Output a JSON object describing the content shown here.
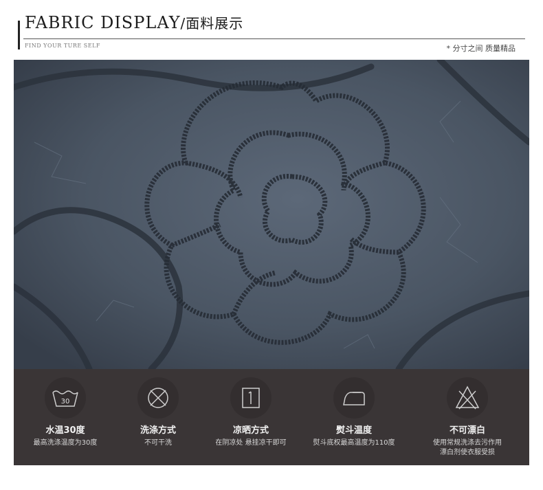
{
  "header": {
    "title_en": "FABRIC DISPLAY",
    "title_zh": "/面料展示",
    "subtitle_en": "FIND YOUR TURE SELF",
    "subtitle_zh": "* 分寸之间 质量精品"
  },
  "photo": {
    "subject": "fabric-closeup",
    "color": "#4d5866"
  },
  "care": {
    "background": "#3a3536",
    "items": [
      {
        "icon": "wash-30-icon",
        "icon_text": "30",
        "title": "水温30度",
        "desc": "最高洗涤温度为30度"
      },
      {
        "icon": "no-wash-icon",
        "title": "洗涤方式",
        "desc": "不可干洗"
      },
      {
        "icon": "drip-dry-icon",
        "title": "凉晒方式",
        "desc": "在阴凉处 悬挂凉干即可"
      },
      {
        "icon": "iron-icon",
        "title": "熨斗温度",
        "desc": "熨斗底权最高温度为110度"
      },
      {
        "icon": "no-bleach-icon",
        "title": "不可漂白",
        "desc": "使用常规洗涤去污作用\n漂白剂使衣服受损"
      }
    ]
  }
}
